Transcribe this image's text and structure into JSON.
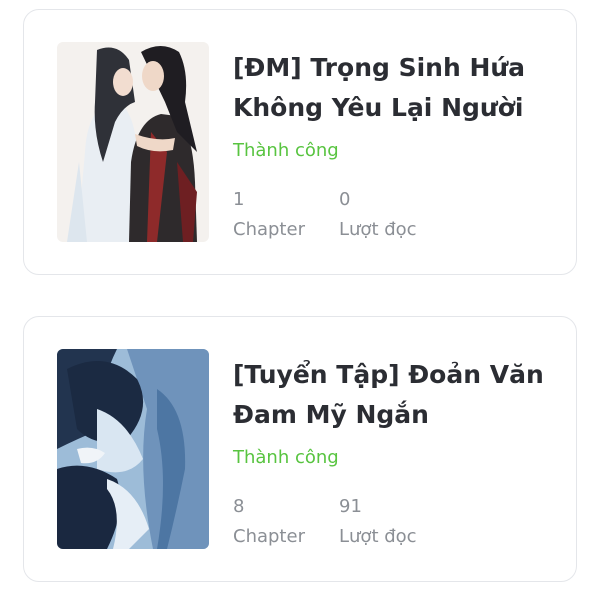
{
  "stories": [
    {
      "title": "[ĐM] Trọng Sinh Hứa Không Yêu Lại Người",
      "status": "Thành công",
      "chapters": "1",
      "chapters_label": "Chapter",
      "views": "0",
      "views_label": "Lượt đọc",
      "cover": "cover-illustration-two-figures"
    },
    {
      "title": "[Tuyển Tập] Đoản Văn Đam Mỹ Ngắn",
      "status": "Thành công",
      "chapters": "8",
      "chapters_label": "Chapter",
      "views": "91",
      "views_label": "Lượt đọc",
      "cover": "cover-illustration-blue-figures"
    }
  ],
  "colors": {
    "status": "#58c440",
    "title": "#2b2d33",
    "meta": "#8b8f95",
    "card_border": "#e4e6ea"
  }
}
